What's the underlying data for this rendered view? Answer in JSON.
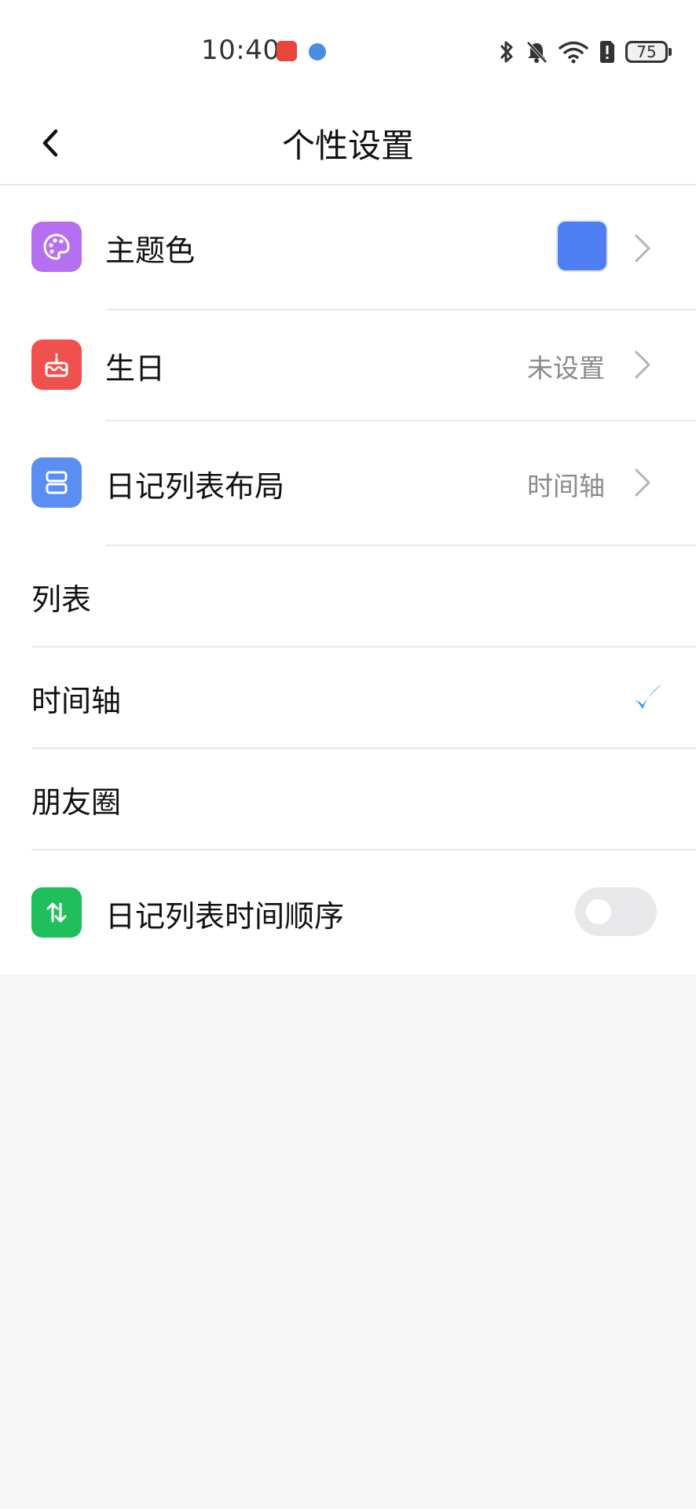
{
  "status_bar": {
    "time": "10:40",
    "battery": "75"
  },
  "header": {
    "title": "个性设置"
  },
  "settings": {
    "theme": {
      "label": "主题色",
      "icon": "palette-icon",
      "icon_color": "#b66ff0",
      "value_color": "#4f7ef2"
    },
    "birthday": {
      "label": "生日",
      "value": "未设置",
      "icon": "cake-icon",
      "icon_color": "#f0504e"
    },
    "layout": {
      "label": "日记列表布局",
      "value": "时间轴",
      "icon": "layout-icon",
      "icon_color": "#5a8ef0",
      "options": [
        {
          "label": "列表",
          "selected": false
        },
        {
          "label": "时间轴",
          "selected": true
        },
        {
          "label": "朋友圈",
          "selected": false
        }
      ]
    },
    "order": {
      "label": "日记列表时间顺序",
      "icon": "sort-arrows-icon",
      "icon_color": "#1fbf5c",
      "enabled": false
    }
  },
  "colors": {
    "check": "#1e9be8"
  }
}
